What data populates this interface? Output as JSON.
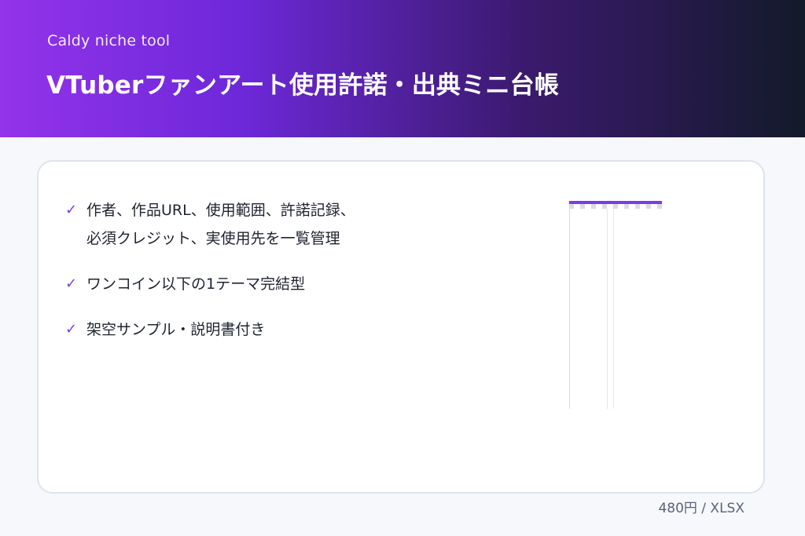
{
  "header": {
    "brand": "Caldy niche tool",
    "title": "VTuberファンアート使用許諾・出典ミニ台帳"
  },
  "features": [
    {
      "check_icon": "✔",
      "lines": [
        "作者、作品URL、使用範囲、許諾記録、",
        "必須クレジット、実使用先を一覧管理"
      ]
    },
    {
      "check_icon": "✔",
      "lines": [
        "ワンコイン以下の1テーマ完結型"
      ]
    },
    {
      "check_icon": "✔",
      "lines": [
        "架空サンプル・説明書付き"
      ]
    }
  ],
  "price": "480円 / XLSX",
  "colors": {
    "accent": "#7c3aed",
    "hero_start": "#9333ea",
    "hero_end": "#131a2a"
  }
}
